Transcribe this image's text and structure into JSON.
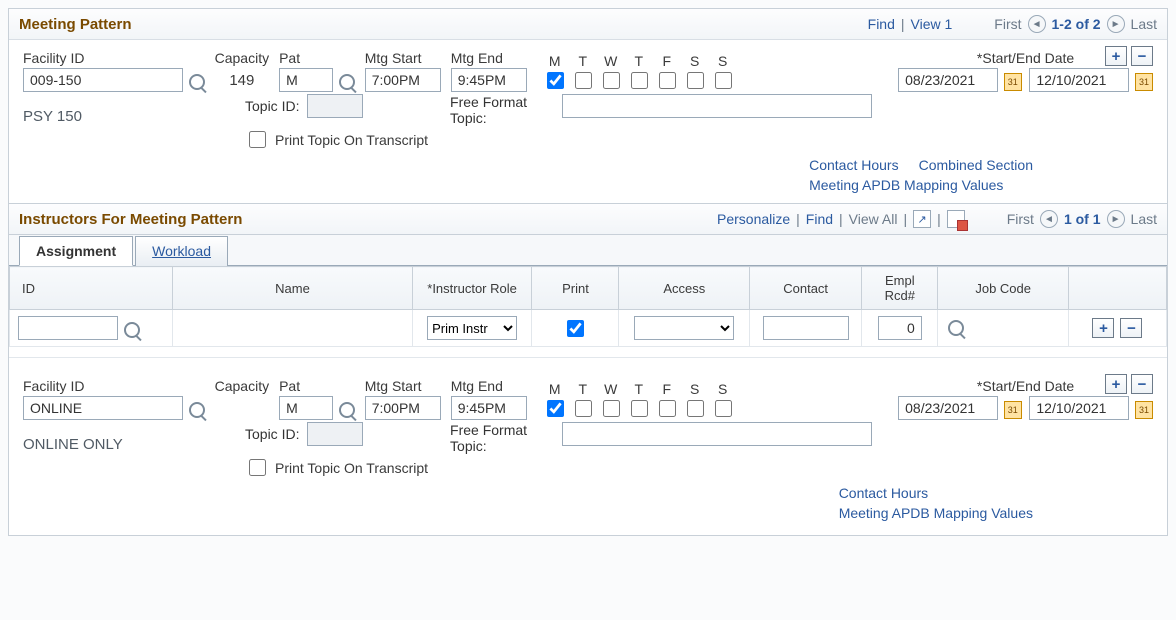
{
  "meeting_pattern": {
    "title": "Meeting Pattern",
    "nav": {
      "find": "Find",
      "view1": "View 1",
      "first": "First",
      "counter": "1-2 of 2",
      "last": "Last"
    },
    "labels": {
      "facility_id": "Facility ID",
      "capacity": "Capacity",
      "pat": "Pat",
      "mtg_start": "Mtg Start",
      "mtg_end": "Mtg End",
      "start_end_date": "*Start/End Date",
      "topic_id": "Topic ID:",
      "free_format_topic": "Free Format Topic:",
      "print_topic": "Print Topic On Transcript"
    },
    "day_letters": [
      "M",
      "T",
      "W",
      "T",
      "F",
      "S",
      "S"
    ],
    "links": {
      "contact_hours": "Contact Hours",
      "combined_section": "Combined Section",
      "apdb": "Meeting APDB Mapping Values"
    },
    "rows": [
      {
        "facility_id": "009-150",
        "capacity": "149",
        "pat": "M",
        "mtg_start": "7:00PM",
        "mtg_end": "9:45PM",
        "days": [
          true,
          false,
          false,
          false,
          false,
          false,
          false
        ],
        "start_date": "08/23/2021",
        "end_date": "12/10/2021",
        "facility_desc": "PSY 150",
        "topic_id": "",
        "free_format_topic": "",
        "print_topic": false,
        "show_combined": true
      },
      {
        "facility_id": "ONLINE",
        "capacity": "",
        "pat": "M",
        "mtg_start": "7:00PM",
        "mtg_end": "9:45PM",
        "days": [
          true,
          false,
          false,
          false,
          false,
          false,
          false
        ],
        "start_date": "08/23/2021",
        "end_date": "12/10/2021",
        "facility_desc": "ONLINE  ONLY",
        "topic_id": "",
        "free_format_topic": "",
        "print_topic": false,
        "show_combined": false
      }
    ]
  },
  "instructors": {
    "title": "Instructors For Meeting Pattern",
    "nav": {
      "personalize": "Personalize",
      "find": "Find",
      "view_all": "View All",
      "first": "First",
      "counter": "1 of 1",
      "last": "Last"
    },
    "tabs": {
      "assignment": "Assignment",
      "workload": "Workload",
      "active": "assignment"
    },
    "columns": {
      "id": "ID",
      "name": "Name",
      "role": "*Instructor Role",
      "print": "Print",
      "access": "Access",
      "contact": "Contact",
      "empl": "Empl Rcd#",
      "job": "Job Code"
    },
    "row": {
      "id": "",
      "name": "",
      "role": "Prim Instr",
      "print": true,
      "access": "",
      "contact": "",
      "empl": "0",
      "job": ""
    }
  }
}
